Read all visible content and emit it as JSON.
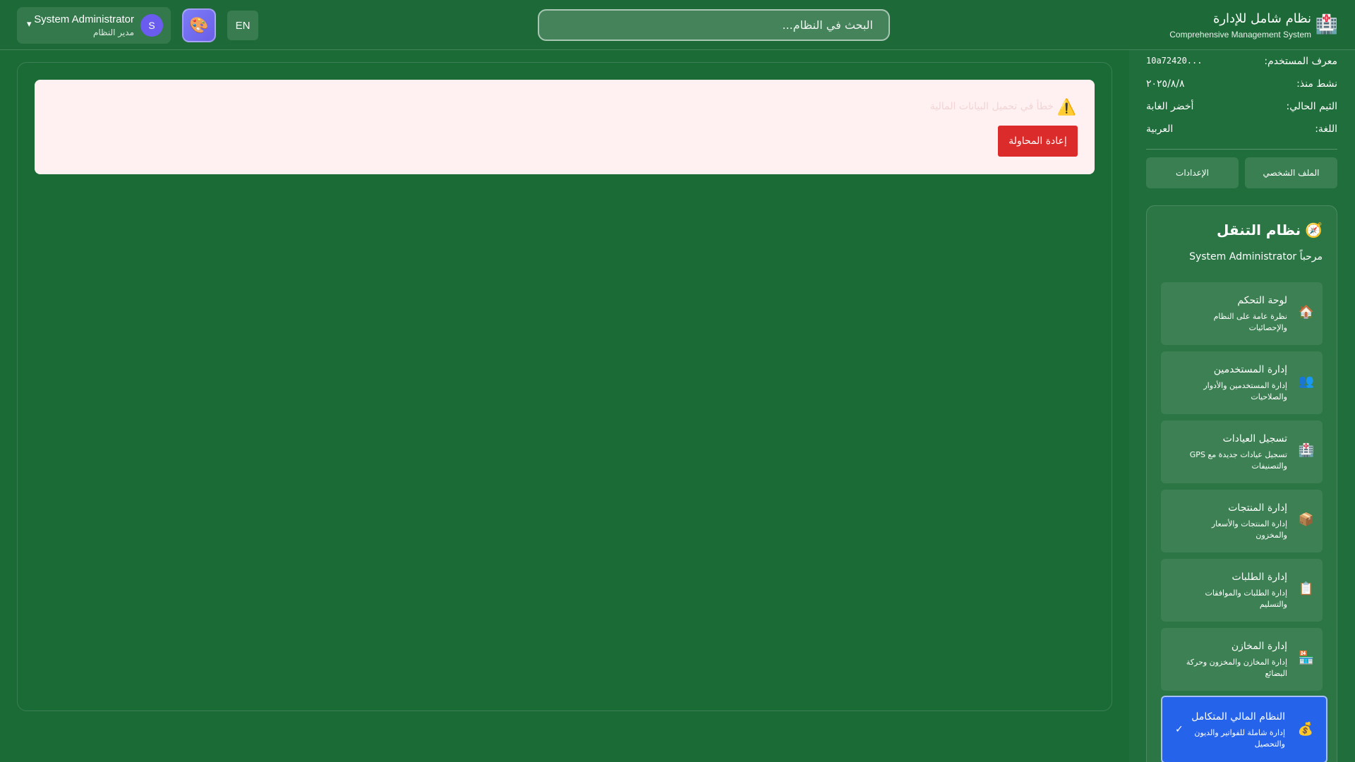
{
  "header": {
    "user": {
      "name": "System Administrator",
      "role": "مدير النظام",
      "avatar_letter": "S",
      "caret": "▾"
    },
    "theme_icon": "🎨",
    "language_button": "EN",
    "search": {
      "placeholder": "البحث في النظام..."
    },
    "brand": {
      "icon": "🏥",
      "title": "نظام شامل للإدارة",
      "subtitle": "Comprehensive Management System"
    }
  },
  "main": {
    "error": {
      "icon": "⚠️",
      "message": "خطأ في تحميل البيانات المالية",
      "retry_label": "إعادة المحاولة"
    }
  },
  "sidebar": {
    "info": [
      {
        "label": "معرف المستخدم:",
        "value": "...10a72420"
      },
      {
        "label": "نشط منذ:",
        "value": "٢٠٢٥/٨/٨"
      },
      {
        "label": "الثيم الحالي:",
        "value": "أخضر الغابة"
      },
      {
        "label": "اللغة:",
        "value": "العربية"
      }
    ],
    "profile_label": "الملف الشخصي",
    "settings_label": "الإعدادات",
    "nav": {
      "icon": "🧭",
      "title": "نظام التنقل",
      "welcome": "مرحباً System Administrator",
      "items": [
        {
          "icon": "🏠",
          "label": "لوحة التحكم",
          "desc": "نظرة عامة على النظام والإحصائيات"
        },
        {
          "icon": "👥",
          "label": "إدارة المستخدمين",
          "desc": "إدارة المستخدمين والأدوار والصلاحيات"
        },
        {
          "icon": "🏥",
          "label": "تسجيل العيادات",
          "desc": "تسجيل عيادات جديدة مع GPS والتصنيفات"
        },
        {
          "icon": "📦",
          "label": "إدارة المنتجات",
          "desc": "إدارة المنتجات والأسعار والمخزون"
        },
        {
          "icon": "📋",
          "label": "إدارة الطلبات",
          "desc": "إدارة الطلبات والموافقات والتسليم"
        },
        {
          "icon": "🏪",
          "label": "إدارة المخازن",
          "desc": "إدارة المخازن والمخزون وحركة البضائع"
        },
        {
          "icon": "💰",
          "label": "النظام المالي المتكامل",
          "desc": "إدارة شاملة للفواتير والديون والتحصيل",
          "check": "✓"
        }
      ]
    }
  }
}
